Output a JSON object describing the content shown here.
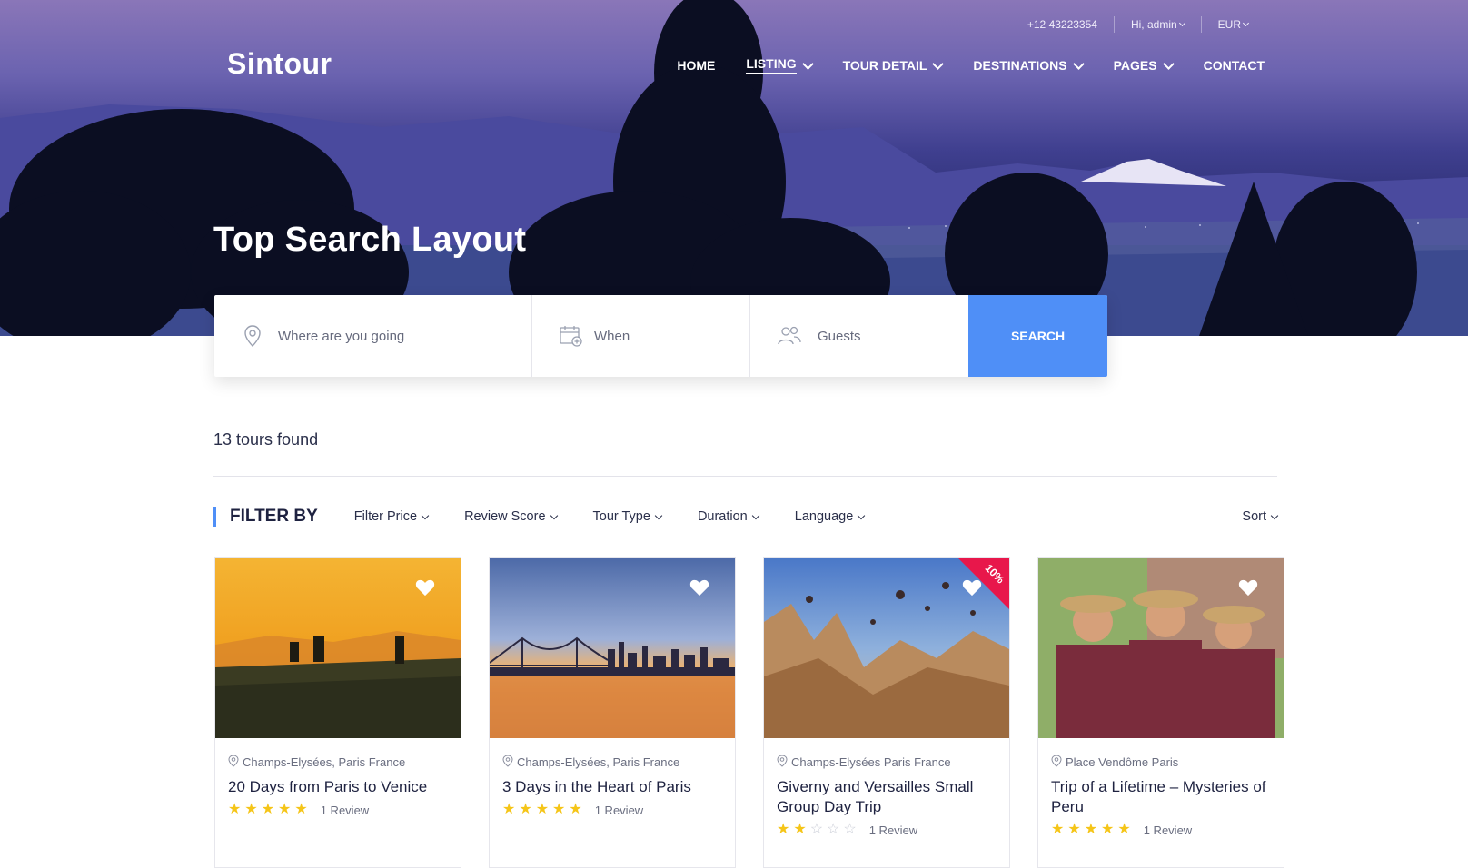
{
  "header": {
    "phone": "+12 43223354",
    "user": "Hi, admin",
    "currency": "EUR",
    "logo": "Sintour",
    "nav": [
      {
        "label": "HOME",
        "dropdown": false,
        "active": false
      },
      {
        "label": "LISTING",
        "dropdown": true,
        "active": true
      },
      {
        "label": "TOUR DETAIL",
        "dropdown": true,
        "active": false
      },
      {
        "label": "DESTINATIONS",
        "dropdown": true,
        "active": false
      },
      {
        "label": "PAGES",
        "dropdown": true,
        "active": false
      },
      {
        "label": "CONTACT",
        "dropdown": false,
        "active": false
      }
    ]
  },
  "hero": {
    "title": "Top Search Layout"
  },
  "search": {
    "where_placeholder": "Where are you going",
    "when_placeholder": "When",
    "guests_placeholder": "Guests",
    "button": "SEARCH"
  },
  "results": {
    "count_text": "13 tours found"
  },
  "filters": {
    "label": "FILTER BY",
    "options": [
      "Filter Price",
      "Review Score",
      "Tour Type",
      "Duration",
      "Language"
    ],
    "sort": "Sort"
  },
  "tours": [
    {
      "location": "Champs-Elysées, Paris France",
      "title": "20 Days from Paris to Venice",
      "stars": 5,
      "reviews": "1 Review",
      "badge": ""
    },
    {
      "location": "Champs-Elysées, Paris France",
      "title": "3 Days in the Heart of Paris",
      "stars": 5,
      "reviews": "1 Review",
      "badge": ""
    },
    {
      "location": "Champs-Elysées Paris France",
      "title": "Giverny and Versailles Small Group Day Trip",
      "stars": 2,
      "reviews": "1 Review",
      "badge": "10%"
    },
    {
      "location": "Place Vendôme Paris",
      "title": "Trip of a Lifetime – Mysteries of Peru",
      "stars": 5,
      "reviews": "1 Review",
      "badge": ""
    }
  ],
  "colors": {
    "accent": "#4f8ff7",
    "star": "#f5c518",
    "star_empty": "#c9ccd6",
    "badge": "#e8174b"
  },
  "icons": [
    "map-pin-icon",
    "calendar-icon",
    "users-icon",
    "heart-icon",
    "star-icon",
    "chevron-down-icon"
  ]
}
